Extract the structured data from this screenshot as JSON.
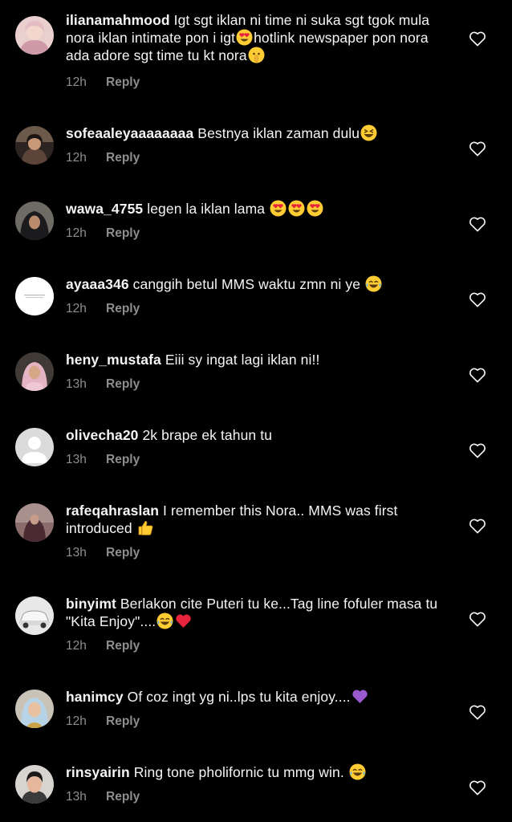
{
  "comments": [
    {
      "username": "ilianamahmood",
      "segments": [
        {
          "text": " Igt sgt iklan ni time ni suka sgt tgok mula nora iklan intimate pon i igt"
        },
        {
          "emoji": "heart-eyes-emoji"
        },
        {
          "text": "hotlink newspaper pon nora ada adore sgt time tu kt nora"
        },
        {
          "emoji": "shushing-face-emoji"
        }
      ],
      "time": "12h",
      "reply": "Reply",
      "avatar": "avatar-ilianamahmood"
    },
    {
      "username": "sofeaaleyaaaaaaaa",
      "segments": [
        {
          "text": " Bestnya iklan zaman dulu"
        },
        {
          "emoji": "laughing-squint-emoji"
        }
      ],
      "time": "12h",
      "reply": "Reply",
      "avatar": "avatar-sofeaaleyaaaaaaaa"
    },
    {
      "username": "wawa_4755",
      "segments": [
        {
          "text": " legen la iklan lama "
        },
        {
          "emoji": "heart-eyes-emoji"
        },
        {
          "emoji": "heart-eyes-emoji"
        },
        {
          "emoji": "heart-eyes-emoji"
        }
      ],
      "time": "12h",
      "reply": "Reply",
      "avatar": "avatar-wawa_4755"
    },
    {
      "username": "ayaaa346",
      "segments": [
        {
          "text": " canggih betul MMS waktu zmn ni ye "
        },
        {
          "emoji": "tears-of-joy-emoji"
        }
      ],
      "time": "12h",
      "reply": "Reply",
      "avatar": "avatar-ayaaa346"
    },
    {
      "username": "heny_mustafa",
      "segments": [
        {
          "text": " Eiii sy ingat lagi iklan ni!!"
        }
      ],
      "time": "13h",
      "reply": "Reply",
      "avatar": "avatar-heny_mustafa"
    },
    {
      "username": "olivecha20",
      "segments": [
        {
          "text": " 2k brape ek tahun tu"
        }
      ],
      "time": "13h",
      "reply": "Reply",
      "avatar": "avatar-default"
    },
    {
      "username": "rafeqahraslan",
      "segments": [
        {
          "text": " I remember this Nora.. MMS was first introduced "
        },
        {
          "emoji": "thumbs-up-emoji"
        }
      ],
      "time": "13h",
      "reply": "Reply",
      "avatar": "avatar-rafeqahraslan"
    },
    {
      "username": "binyimt",
      "segments": [
        {
          "text": " Berlakon cite Puteri tu ke...Tag line fofuler masa tu \"Kita Enjoy\"...."
        },
        {
          "emoji": "tears-of-joy-emoji"
        },
        {
          "emoji": "red-heart-emoji"
        }
      ],
      "time": "12h",
      "reply": "Reply",
      "avatar": "avatar-binyimt"
    },
    {
      "username": "hanimcy",
      "segments": [
        {
          "text": " Of coz ingt yg ni..lps tu kita enjoy...."
        },
        {
          "emoji": "purple-heart-emoji"
        }
      ],
      "time": "12h",
      "reply": "Reply",
      "avatar": "avatar-hanimcy"
    },
    {
      "username": "rinsyairin",
      "segments": [
        {
          "text": " Ring tone pholifornic tu mmg win. "
        },
        {
          "emoji": "tears-of-joy-emoji"
        }
      ],
      "time": "13h",
      "reply": "Reply",
      "avatar": "avatar-rinsyairin"
    }
  ],
  "colors": {
    "background": "#000000",
    "text": "#f5f5f5",
    "secondary": "#8e8e8e",
    "emoji_yellow": "#ffcc33",
    "heart_red": "#e8243c",
    "heart_purple": "#9b59d0"
  },
  "icons": {
    "like": "heart-outline-icon"
  }
}
